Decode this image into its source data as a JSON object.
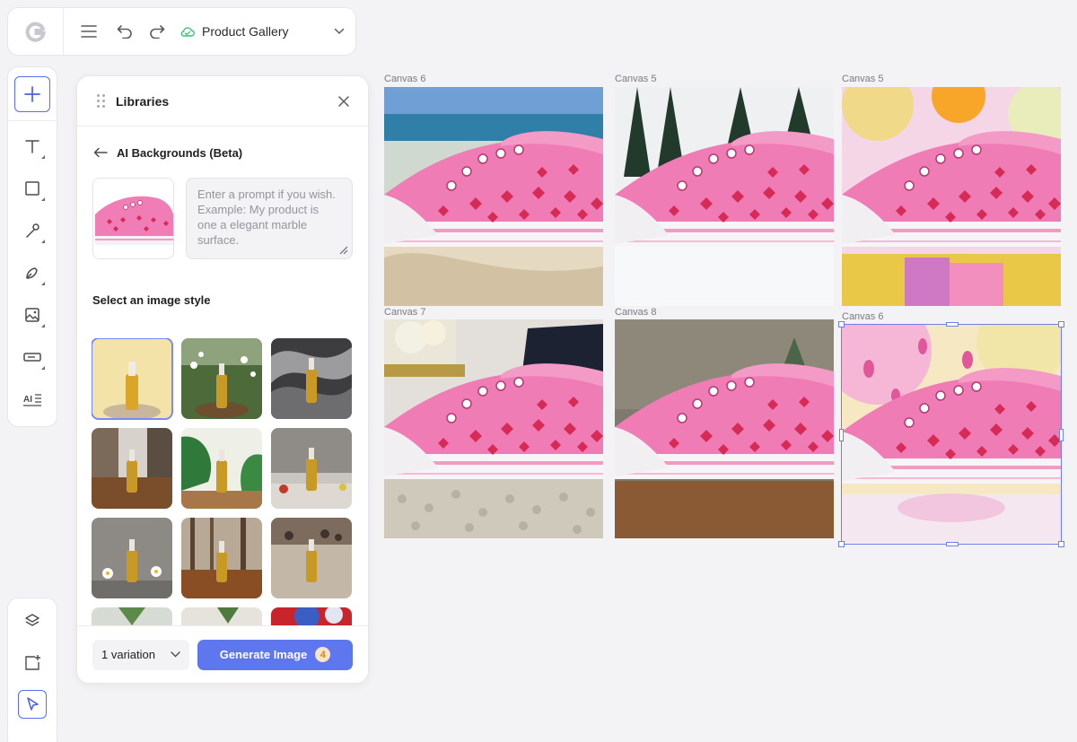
{
  "app": {
    "logo": "G",
    "project_name": "Product Gallery"
  },
  "topbar": {
    "menu_icon": "hamburger-icon",
    "undo_icon": "undo-icon",
    "redo_icon": "redo-icon",
    "cloud_icon": "cloud-icon"
  },
  "panel": {
    "title": "Libraries",
    "section_title": "AI Backgrounds (Beta)",
    "prompt_placeholder": "Enter a prompt if you wish. Example: My product is one a elegant marble surface.",
    "style_label": "Select an image style",
    "variation_label": "1 variation",
    "generate_label": "Generate Image",
    "generate_count": "4"
  },
  "canvases": [
    {
      "label": "Canvas 6",
      "scene": "beach"
    },
    {
      "label": "Canvas 5",
      "scene": "snow"
    },
    {
      "label": "Canvas 5",
      "scene": "candy"
    },
    {
      "label": "Canvas 7",
      "scene": "room"
    },
    {
      "label": "Canvas 8",
      "scene": "forest"
    },
    {
      "label": "Canvas 6",
      "scene": "petals"
    }
  ],
  "colors": {
    "accent": "#5f77ee",
    "badge_bg": "#fbe3c7",
    "badge_text": "#d4871f",
    "shoe_pink": "#f078b4",
    "heart_red": "#d62b57"
  }
}
